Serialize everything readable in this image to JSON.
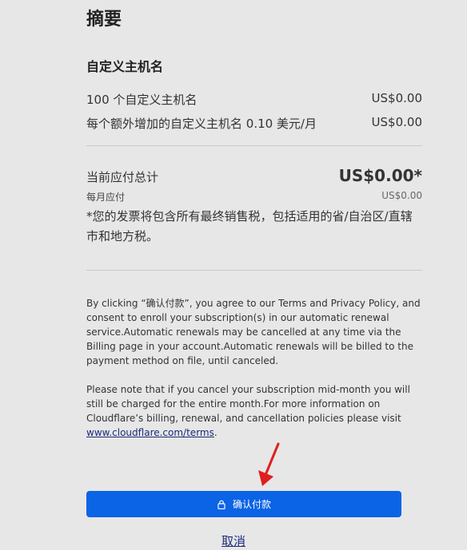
{
  "summary": {
    "title": "摘要",
    "section_title": "自定义主机名",
    "items": [
      {
        "label": "100 个自定义主机名",
        "amount": "US$0.00"
      },
      {
        "label": "每个额外增加的自定义主机名 0.10 美元/月",
        "amount": "US$0.00"
      }
    ],
    "total_label": "当前应付总计",
    "total_amount": "US$0.00*",
    "monthly_label": "每月应付",
    "monthly_amount": "US$0.00",
    "tax_note": "*您的发票将包含所有最终销售税，包括适用的省/自治区/直辖市和地方税。"
  },
  "legal": {
    "paragraph1": "By clicking “确认付款”, you agree to our Terms and Privacy Policy, and consent to enroll your subscription(s) in our automatic renewal service.Automatic renewals may be cancelled at any time via the Billing page in your account.Automatic renewals will be billed to the payment method on file, until canceled.",
    "paragraph2": "Please note that if you cancel your subscription mid-month you will still be charged for the entire month.For more information on Cloudflare’s billing, renewal, and cancellation policies please visit",
    "terms_link": "www.cloudflare.com/terms",
    "terms_suffix": "."
  },
  "actions": {
    "confirm_label": "确认付款",
    "cancel_label": "取消"
  },
  "colors": {
    "background": "#e7e7e7",
    "primary_button": "#0b63e5",
    "annotation_arrow": "#e01f1f"
  },
  "icons": {
    "confirm_icon": "lock-icon"
  }
}
